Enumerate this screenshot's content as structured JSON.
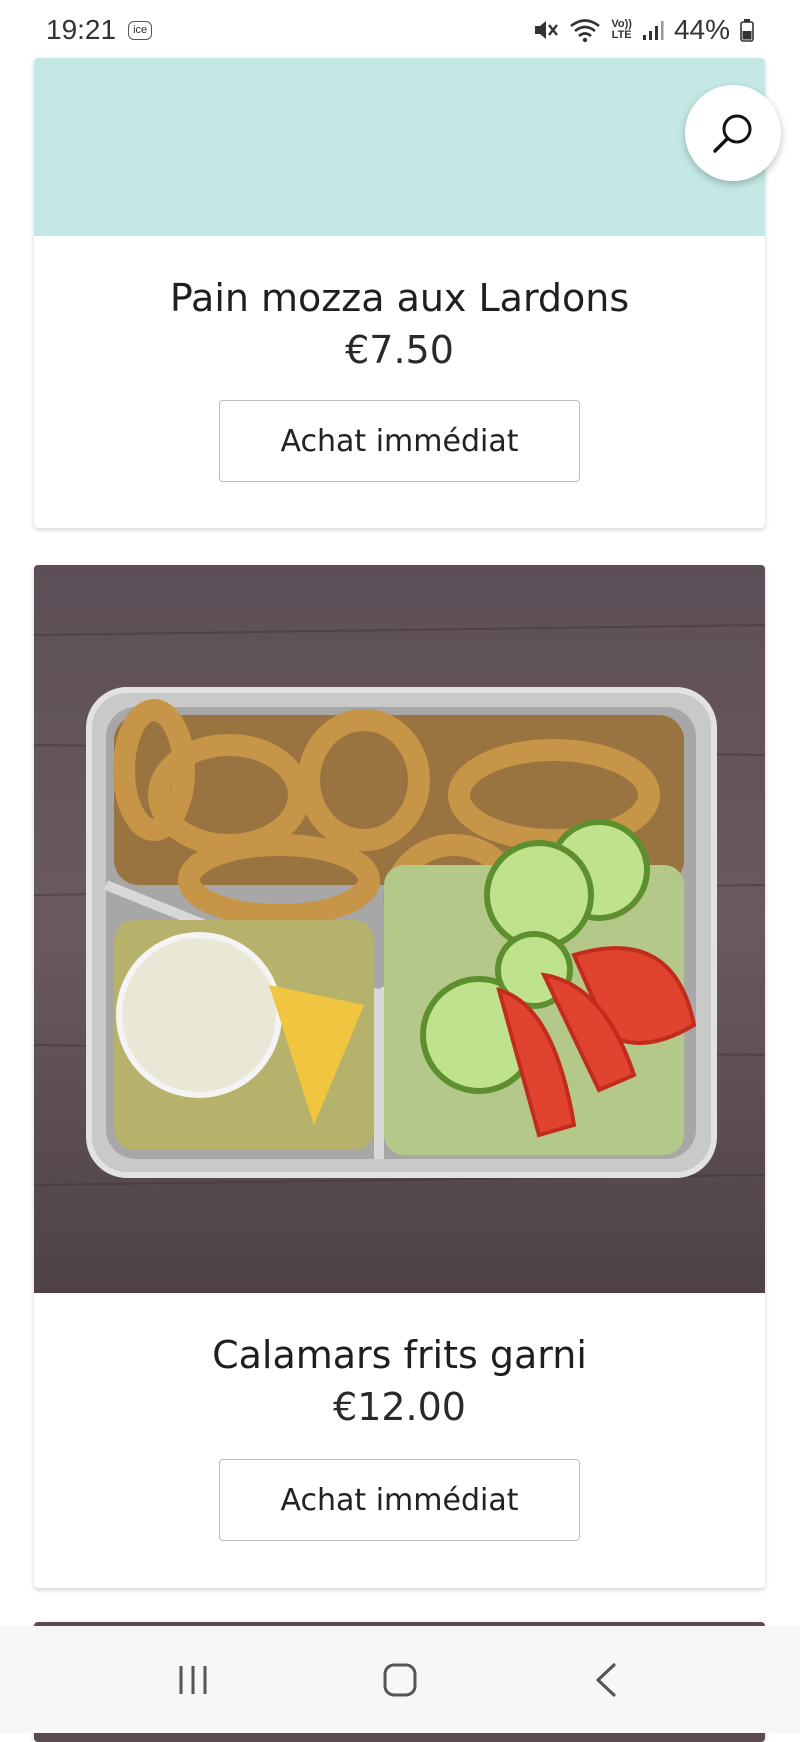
{
  "status_bar": {
    "time": "19:21",
    "badge": "ice",
    "network_label_top": "Vo))",
    "network_label_bottom": "LTE",
    "battery": "44%"
  },
  "products": [
    {
      "name": "Pain mozza aux Lardons",
      "price": "€7.50",
      "button": "Achat immédiat",
      "image": "teal-placeholder",
      "image_color": "#c4e9e5"
    },
    {
      "name": "Calamars frits garni",
      "price": "€12.00",
      "button": "Achat immédiat",
      "image": "fried-calamari-tray"
    }
  ],
  "icons": {
    "search": "search-icon",
    "recents": "recents-icon",
    "home": "home-icon",
    "back": "back-icon"
  },
  "colors": {
    "teal": "#c4e9e5",
    "wood": "#5b4a52"
  }
}
